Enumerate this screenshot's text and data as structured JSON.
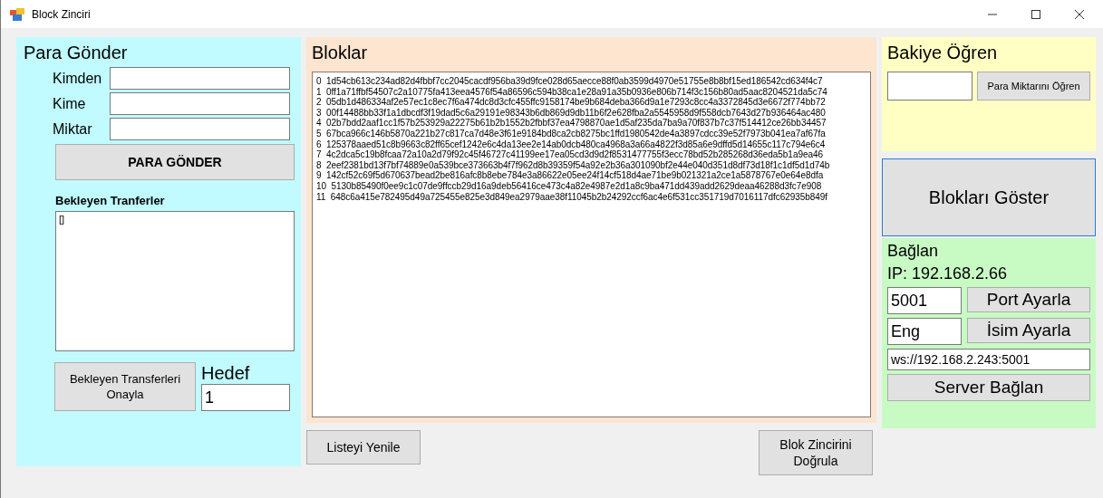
{
  "window": {
    "title": "Block Zinciri"
  },
  "send_panel": {
    "title": "Para Gönder",
    "fields": [
      {
        "label": "Kimden"
      },
      {
        "label": "Kime"
      },
      {
        "label": "Miktar"
      }
    ],
    "send_button": "PARA GÖNDER",
    "pending_label": "Bekleyen Tranferler",
    "pending_items": [
      "[]"
    ],
    "approve_button": "Bekleyen Transferleri Onayla",
    "target_label": "Hedef",
    "target_value": "1"
  },
  "blocks_panel": {
    "title": "Bloklar",
    "rows": [
      {
        "index": "0",
        "hash": "1d54cb613c234ad82d4fbbf7cc2045cacdf956ba39d9fce028d65aecce88f0ab3599d4970e51755e8b8bf15ed186542cd634f4c7"
      },
      {
        "index": "1",
        "hash": "0ff1a71ffbf54507c2a10775fa413eea4576f54a86596c594b38ca1e28a91a35b0936e806b714f3c156b80ad5aac8204521da5c74"
      },
      {
        "index": "2",
        "hash": "05db1d486334af2e57ec1c8ec7f6a474dc8d3cfc455ffc9158174be9b684deba366d9a1e7293c8cc4a3372845d3e6672f774bb72"
      },
      {
        "index": "3",
        "hash": "00f14488bb33f1a1dbcdf3f19dad5c6a29191e98343b6db869d9db11b6f2e628fba2a5545958d9f558dcb7643d27b936464ac480"
      },
      {
        "index": "4",
        "hash": "02b7bdd2aaf1cc1f57b253929a22275b61b2b1552b2fbbf37ea4798870ae1d5af235da7ba9a70f837b7c37f514412ce26bb34457"
      },
      {
        "index": "5",
        "hash": "67bca966c146b5870a221b27c817ca7d48e3f61e9184bd8ca2cb8275bc1ffd1980542de4a3897cdcc39e52f7973b041ea7af67fa"
      },
      {
        "index": "6",
        "hash": "125378aaed51c8b9663c82ff65cef1242e6c4da13ee2e14ab0dcb480ca4968a3a66a4822f3d85a6e9dffd5d14655c117c794e6c4"
      },
      {
        "index": "7",
        "hash": "4c2dca5c19b8fcaa72a10a2d79f92c45f46727c41199ee17ea05cd3d9d2f8531477755f3ecc78bd52b285268d36eda5b1a9ea46"
      },
      {
        "index": "8",
        "hash": "2eef2381bd13f7bf74889e0a539bce373663b4f7f962d8b39359f54a92e2b36a301090bf2e44e040d351d8df73d18f1c1df5d1d74b"
      },
      {
        "index": "9",
        "hash": "142cf52c69f5d670637bead2be816afc8b8ebe784e3a86622e05ee24f14cf518d4ae71be9b021321a2ce1a5878767e0e64e8dfa"
      },
      {
        "index": "10",
        "hash": "5130b85490f0ee9c1c07de9ffccb29d16a9deb56416ce473c4a82e4987e2d1a8c9ba471dd439add2629deaa46288d3fc7e908"
      },
      {
        "index": "11",
        "hash": "648c6a415e782495d49a725455e825e3d849ea2979aae38f11045b2b24292ccf6ac4e6f531cc351719d7016117dfc62935b849f"
      }
    ],
    "refresh_button": "Listeyi Yenile",
    "verify_button": "Blok Zincirini Doğrula"
  },
  "balance_panel": {
    "title": "Bakiye Öğren",
    "button": "Para Miktarını Öğren"
  },
  "show_blocks_button": "Blokları Göster",
  "connect_panel": {
    "title": "Bağlan",
    "ip": "IP: 192.168.2.66",
    "port_value": "5001",
    "port_button": "Port Ayarla",
    "name_value": "Eng",
    "name_button": "İsim Ayarla",
    "url_value": "ws://192.168.2.243:5001",
    "connect_button": "Server Bağlan"
  }
}
